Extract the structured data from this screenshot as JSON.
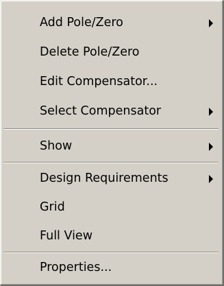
{
  "menu": {
    "items": [
      {
        "label": "Add Pole/Zero",
        "submenu": true
      },
      {
        "label": "Delete Pole/Zero",
        "submenu": false
      },
      {
        "label": "Edit Compensator...",
        "submenu": false
      },
      {
        "label": "Select Compensator",
        "submenu": true
      },
      {
        "label": "Show",
        "submenu": true
      },
      {
        "label": "Design Requirements",
        "submenu": true
      },
      {
        "label": "Grid",
        "submenu": false
      },
      {
        "label": "Full View",
        "submenu": false
      },
      {
        "label": "Properties...",
        "submenu": false
      }
    ]
  }
}
